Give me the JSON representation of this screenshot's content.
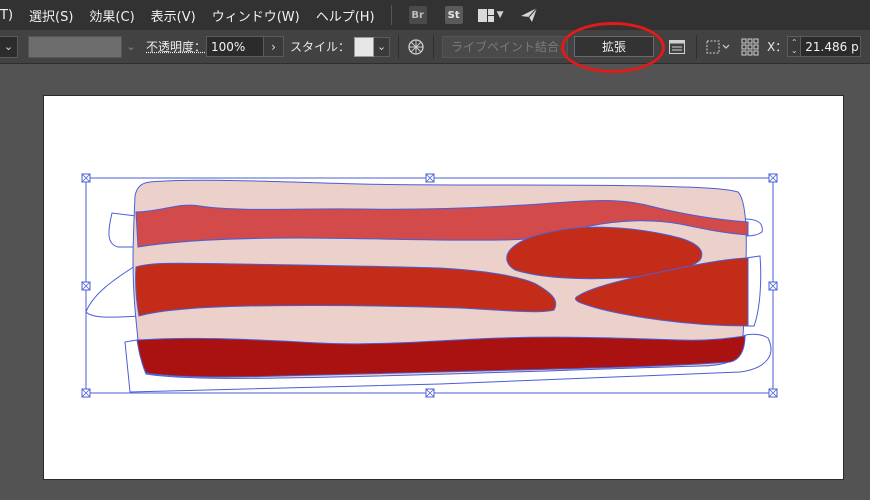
{
  "menubar": {
    "items": [
      "T)",
      "選択(S)",
      "効果(C)",
      "表示(V)",
      "ウィンドウ(W)",
      "ヘルプ(H)"
    ],
    "bridge_icon": "Br",
    "stock_icon": "St",
    "workspace_icon": "workspace-switcher-icon",
    "send_icon": "paper-plane-icon"
  },
  "controlbar": {
    "opacity_label": "不透明度：",
    "opacity_value": "100%",
    "style_label": "スタイル：",
    "live_paint_label": "ライブペイント結合",
    "expand_label": "拡張",
    "x_label": "X：",
    "x_value": "21.486 p"
  },
  "colors": {
    "fat": "#ecd1cb",
    "stripe_light": "#d24a4a",
    "stripe_mid": "#c42c1a",
    "stripe_dark": "#a91210",
    "selection": "#4a5ed6",
    "annotation_circle": "#e11a1a"
  }
}
